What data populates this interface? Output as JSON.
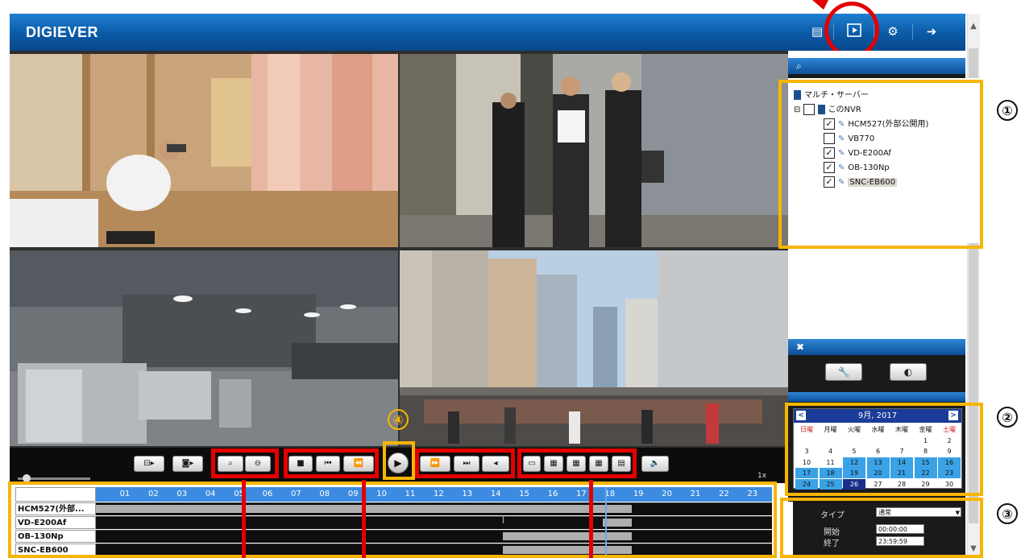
{
  "header": {
    "logo": "DIGIEVER",
    "icons": [
      "layout-icon",
      "playback-icon",
      "settings-icon",
      "logout-icon"
    ]
  },
  "tree": {
    "root": "マルチ・サーバー",
    "nvr": "このNVR",
    "cameras": [
      {
        "label": "HCM527(外部公開用)",
        "checked": true
      },
      {
        "label": "VB770",
        "checked": false
      },
      {
        "label": "VD-E200Af",
        "checked": true
      },
      {
        "label": "OB-130Np",
        "checked": true
      },
      {
        "label": "SNC-EB600",
        "checked": true
      }
    ]
  },
  "annotations": [
    "①",
    "②",
    "③",
    "④"
  ],
  "calendar": {
    "title": "9月, 2017",
    "weekdays": [
      "日曜",
      "月曜",
      "火曜",
      "水曜",
      "木曜",
      "金曜",
      "土曜"
    ],
    "weeks": [
      [
        "",
        "",
        "",
        "",
        "",
        "1",
        "2"
      ],
      [
        "3",
        "4",
        "5",
        "6",
        "7",
        "8",
        "9"
      ],
      [
        "10",
        "11",
        "12",
        "13",
        "14",
        "15",
        "16"
      ],
      [
        "17",
        "18",
        "19",
        "20",
        "21",
        "22",
        "23"
      ],
      [
        "24",
        "25",
        "26",
        "27",
        "28",
        "29",
        "30"
      ]
    ],
    "recorded_days": [
      "12",
      "13",
      "14",
      "15",
      "16",
      "17",
      "18",
      "19",
      "20",
      "21",
      "22",
      "23",
      "24",
      "25"
    ],
    "selected_day": "26"
  },
  "filter": {
    "type_label": "タイプ",
    "type_value": "通常",
    "start_label": "開始",
    "start_value": "00:00:00",
    "end_label": "終了",
    "end_value": "23:59:59"
  },
  "timeline": {
    "hours": [
      "01",
      "02",
      "03",
      "04",
      "05",
      "06",
      "07",
      "08",
      "09",
      "10",
      "11",
      "12",
      "13",
      "14",
      "15",
      "16",
      "17",
      "18",
      "19",
      "20",
      "21",
      "22",
      "23"
    ],
    "rows": [
      "HCM527(外部...",
      "VD-E200Af",
      "OB-130Np",
      "SNC-EB600"
    ],
    "speed": "1x"
  },
  "colors": {
    "header_blue": "#0b5aa6",
    "annotation_red": "#e30000",
    "annotation_yellow": "#f7b500",
    "timeline_blue": "#3c8be0",
    "calendar_rec": "#3aa2e5",
    "calendar_head": "#1a3b97"
  }
}
